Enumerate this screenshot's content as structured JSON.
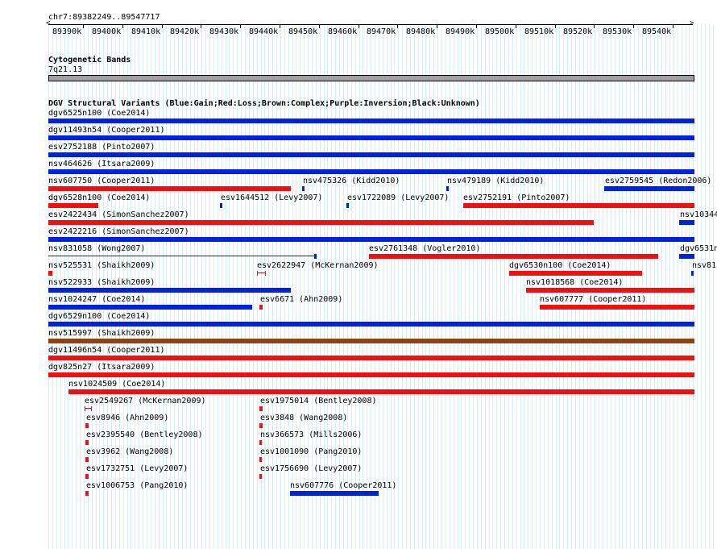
{
  "position_label": "chr7:89382249..89547717",
  "ruler_ticks": [
    "89390k",
    "89400k",
    "89410k",
    "89420k",
    "89430k",
    "89440k",
    "89450k",
    "89460k",
    "89470k",
    "89480k",
    "89490k",
    "89500k",
    "89510k",
    "89520k",
    "89530k",
    "89540k"
  ],
  "cytoband": {
    "title": "Cytogenetic Bands",
    "band_label": "7q21.13"
  },
  "dgv": {
    "title": "DGV Structural Variants (Blue:Gain;Red:Loss;Brown:Complex;Purple:Inversion;Black:Unknown)",
    "variants": [
      {
        "label": "dgv6525n100 (Coe2014)",
        "color": "#0022dd",
        "type": "gain"
      },
      {
        "label": "dgv11493n54 (Cooper2011)",
        "color": "#0022dd",
        "type": "gain"
      },
      {
        "label": "esv2752188 (Pinto2007)",
        "color": "#0022dd",
        "type": "gain"
      },
      {
        "label": "nsv464626 (Itsara2009)",
        "color": "#0022dd",
        "type": "gain"
      },
      {
        "label": "nsv607750 (Cooper2011)",
        "color": "#ee1111",
        "type": "loss"
      },
      {
        "label": "nsv475326 (Kidd2010)",
        "color": "#0022dd",
        "type": "gain"
      },
      {
        "label": "nsv479189 (Kidd2010)",
        "color": "#0022dd",
        "type": "gain"
      },
      {
        "label": "esv2759545 (Redon2006)",
        "color": "#0022dd",
        "type": "gain"
      },
      {
        "label": "dgv6528n100 (Coe2014)",
        "color": "#ee1111",
        "type": "loss"
      },
      {
        "label": "esv1644512 (Levy2007)",
        "color": "#0022dd",
        "type": "gain"
      },
      {
        "label": "esv1722089 (Levy2007)",
        "color": "#0022dd",
        "type": "gain"
      },
      {
        "label": "esv2752191 (Pinto2007)",
        "color": "#ee1111",
        "type": "loss"
      },
      {
        "label": "esv2422434 (SimonSanchez2007)",
        "color": "#ee1111",
        "type": "loss"
      },
      {
        "label": "nsv10344",
        "color": "#0022dd",
        "type": "gain"
      },
      {
        "label": "esv2422216 (SimonSanchez2007)",
        "color": "#0022dd",
        "type": "gain"
      },
      {
        "label": "nsv831058 (Wong2007)",
        "color": "#0022dd",
        "type": "gain"
      },
      {
        "label": "esv2761348 (Vogler2010)",
        "color": "#ee1111",
        "type": "loss"
      },
      {
        "label": "dgv6531n",
        "color": "#0022dd",
        "type": "gain"
      },
      {
        "label": "nsv525531 (Shaikh2009)",
        "color": "#ee1111",
        "type": "loss"
      },
      {
        "label": "esv2622947 (McKernan2009)",
        "color": "#ee1111",
        "type": "loss"
      },
      {
        "label": "dgv6530n100 (Coe2014)",
        "color": "#ee1111",
        "type": "loss"
      },
      {
        "label": "nsv81",
        "color": "#0022dd",
        "type": "gain"
      },
      {
        "label": "nsv522933 (Shaikh2009)",
        "color": "#0022dd",
        "type": "gain"
      },
      {
        "label": "nsv1018568 (Coe2014)",
        "color": "#ee1111",
        "type": "loss"
      },
      {
        "label": "nsv1024247 (Coe2014)",
        "color": "#0022dd",
        "type": "gain"
      },
      {
        "label": "esv6671 (Ahn2009)",
        "color": "#ee1111",
        "type": "loss"
      },
      {
        "label": "nsv607777 (Cooper2011)",
        "color": "#ee1111",
        "type": "loss"
      },
      {
        "label": "dgv6529n100 (Coe2014)",
        "color": "#0022dd",
        "type": "gain"
      },
      {
        "label": "nsv515997 (Shaikh2009)",
        "color": "#8b4513",
        "type": "complex"
      },
      {
        "label": "dgv11496n54 (Cooper2011)",
        "color": "#ee1111",
        "type": "loss"
      },
      {
        "label": "dgv825n27 (Itsara2009)",
        "color": "#ee1111",
        "type": "loss"
      },
      {
        "label": "nsv1024509 (Coe2014)",
        "color": "#ee1111",
        "type": "loss"
      },
      {
        "label": "esv2549267 (McKernan2009)",
        "color": "#ee1111",
        "type": "loss"
      },
      {
        "label": "esv1975014 (Bentley2008)",
        "color": "#ee1111",
        "type": "loss"
      },
      {
        "label": "esv8946 (Ahn2009)",
        "color": "#ee1111",
        "type": "loss"
      },
      {
        "label": "esv3848 (Wang2008)",
        "color": "#ee1111",
        "type": "loss"
      },
      {
        "label": "esv2395540 (Bentley2008)",
        "color": "#ee1111",
        "type": "loss"
      },
      {
        "label": "nsv366573 (Mills2006)",
        "color": "#ee1111",
        "type": "loss"
      },
      {
        "label": "esv3962 (Wang2008)",
        "color": "#ee1111",
        "type": "loss"
      },
      {
        "label": "esv1001090 (Pang2010)",
        "color": "#ee1111",
        "type": "loss"
      },
      {
        "label": "esv1732751 (Levy2007)",
        "color": "#ee1111",
        "type": "loss"
      },
      {
        "label": "esv1756690 (Levy2007)",
        "color": "#ee1111",
        "type": "loss"
      },
      {
        "label": "esv1006753 (Pang2010)",
        "color": "#ee1111",
        "type": "loss"
      },
      {
        "label": "nsv607776 (Cooper2011)",
        "color": "#0022dd",
        "type": "gain"
      }
    ]
  },
  "colors": {
    "gain": "#0022dd",
    "loss": "#ee1111",
    "complex": "#8b4513",
    "grid": "#d6eef5"
  }
}
